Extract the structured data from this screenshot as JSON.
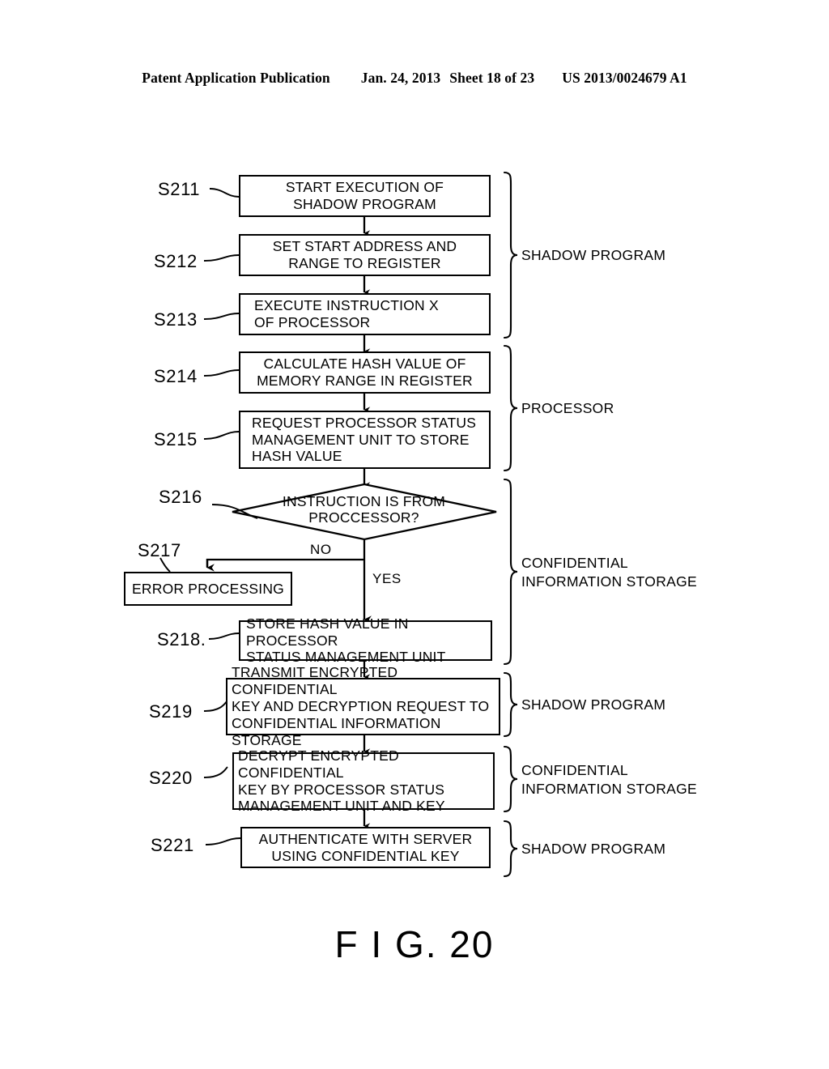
{
  "header": {
    "publication": "Patent Application Publication",
    "date": "Jan. 24, 2013",
    "sheet": "Sheet 18 of 23",
    "number": "US 2013/0024679 A1"
  },
  "figure": {
    "caption": "F I G. 20"
  },
  "flowchart": {
    "nodes": [
      {
        "id": "S211",
        "label": "S211",
        "shape": "process",
        "text": "START EXECUTION OF\nSHADOW PROGRAM"
      },
      {
        "id": "S212",
        "label": "S212",
        "shape": "process",
        "text": "SET START ADDRESS AND\nRANGE TO REGISTER"
      },
      {
        "id": "S213",
        "label": "S213",
        "shape": "process",
        "text": "EXECUTE INSTRUCTION X\nOF PROCESSOR"
      },
      {
        "id": "S214",
        "label": "S214",
        "shape": "process",
        "text": "CALCULATE HASH VALUE OF\nMEMORY RANGE IN REGISTER"
      },
      {
        "id": "S215",
        "label": "S215",
        "shape": "process",
        "text": "REQUEST PROCESSOR STATUS\nMANAGEMENT UNIT TO STORE\nHASH VALUE"
      },
      {
        "id": "S216",
        "label": "S216",
        "shape": "decision",
        "text": "INSTRUCTION IS FROM\nPROCCESSOR?"
      },
      {
        "id": "S217",
        "label": "S217",
        "shape": "process",
        "text": "ERROR PROCESSING"
      },
      {
        "id": "S218",
        "label": "S218.",
        "shape": "process",
        "text": "STORE HASH VALUE IN PROCESSOR\nSTATUS MANAGEMENT UNIT"
      },
      {
        "id": "S219",
        "label": "S219",
        "shape": "process",
        "text": "TRANSMIT ENCRYPTED CONFIDENTIAL\nKEY AND DECRYPTION REQUEST TO\nCONFIDENTIAL INFORMATION STORAGE"
      },
      {
        "id": "S220",
        "label": "S220",
        "shape": "process",
        "text": "DECRYPT ENCRYPTED CONFIDENTIAL\nKEY BY PROCESSOR STATUS\nMANAGEMENT UNIT AND KEY"
      },
      {
        "id": "S221",
        "label": "S221",
        "shape": "process",
        "text": "AUTHENTICATE WITH SERVER\nUSING CONFIDENTIAL KEY"
      }
    ],
    "edge_labels": {
      "no": "NO",
      "yes": "YES"
    },
    "groups": [
      {
        "id": "g1",
        "text": "SHADOW PROGRAM"
      },
      {
        "id": "g2",
        "text": "PROCESSOR"
      },
      {
        "id": "g3",
        "text": "CONFIDENTIAL\nINFORMATION STORAGE"
      },
      {
        "id": "g4",
        "text": "SHADOW PROGRAM"
      },
      {
        "id": "g5",
        "text": "CONFIDENTIAL\nINFORMATION STORAGE"
      },
      {
        "id": "g6",
        "text": "SHADOW PROGRAM"
      }
    ]
  }
}
